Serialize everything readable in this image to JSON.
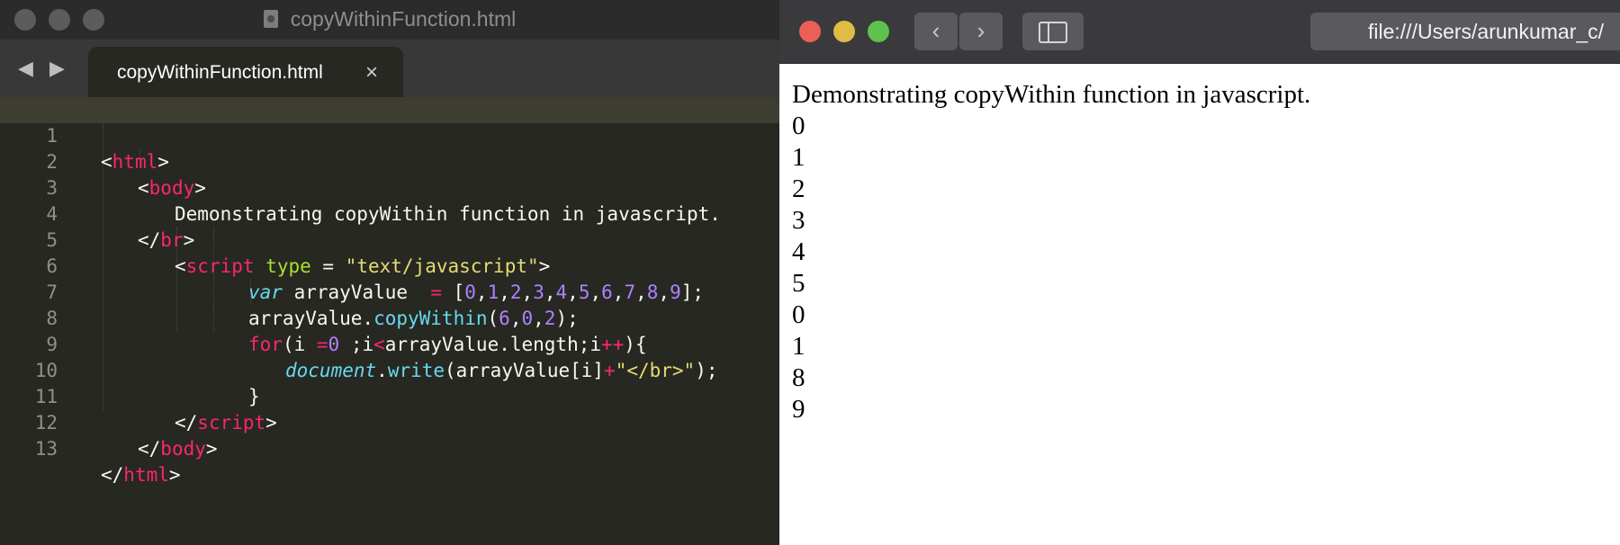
{
  "editor": {
    "title": "copyWithinFunction.html",
    "nav_arrows": "◀ ▶",
    "tab": {
      "label": "copyWithinFunction.html",
      "close": "×"
    },
    "line_numbers": [
      "1",
      "2",
      "3",
      "4",
      "5",
      "6",
      "7",
      "8",
      "9",
      "10",
      "11",
      "12",
      "13"
    ],
    "code": {
      "l1": {
        "lt": "<",
        "tag": "html",
        "gt": ">"
      },
      "l2": {
        "lt": "<",
        "tag": "body",
        "gt": ">"
      },
      "l3": {
        "text": "Demonstrating copyWithin function in javascript."
      },
      "l4": {
        "lt": "</",
        "tag": "br",
        "gt": ">"
      },
      "l5": {
        "lt": "<",
        "tag": "script",
        "attr": "type",
        "eq": " = ",
        "val": "\"text/javascript\"",
        "gt": ">"
      },
      "l6": {
        "kw": "var",
        "name": " arrayValue  ",
        "eq": "=",
        "open": " [",
        "nums": [
          "0",
          "1",
          "2",
          "3",
          "4",
          "5",
          "6",
          "7",
          "8",
          "9"
        ],
        "close": "];"
      },
      "l7": {
        "obj": "arrayValue.",
        "fn": "copyWithin",
        "open": "(",
        "a": "6",
        "b": "0",
        "c": "2",
        "close": ");"
      },
      "l8": {
        "kw": "for",
        "p1": "(i ",
        "op1": "=",
        "zero": "0",
        "p2": " ;i",
        "op2": "<",
        "p3": "arrayValue.length;i",
        "op3": "++",
        "p4": "){"
      },
      "l9": {
        "obj": "document",
        "dot": ".",
        "fn": "write",
        "p1": "(arrayValue[i]",
        "op": "+",
        "str": "\"</br>\"",
        "p2": ");"
      },
      "l10": {
        "text": "}"
      },
      "l11": {
        "lt": "</",
        "tag": "script",
        "gt": ">"
      },
      "l12": {
        "lt": "</",
        "tag": "body",
        "gt": ">"
      },
      "l13": {
        "lt": "</",
        "tag": "html",
        "gt": ">"
      }
    }
  },
  "browser": {
    "back": "‹",
    "forward": "›",
    "address": "file:///Users/arunkumar_c/",
    "page_heading": "Demonstrating copyWithin function in javascript.",
    "output": [
      "0",
      "1",
      "2",
      "3",
      "4",
      "5",
      "0",
      "1",
      "8",
      "9"
    ]
  },
  "colors": {
    "close": "#ec5f57",
    "minimize": "#e0bc46",
    "maximize": "#5fc24e"
  }
}
